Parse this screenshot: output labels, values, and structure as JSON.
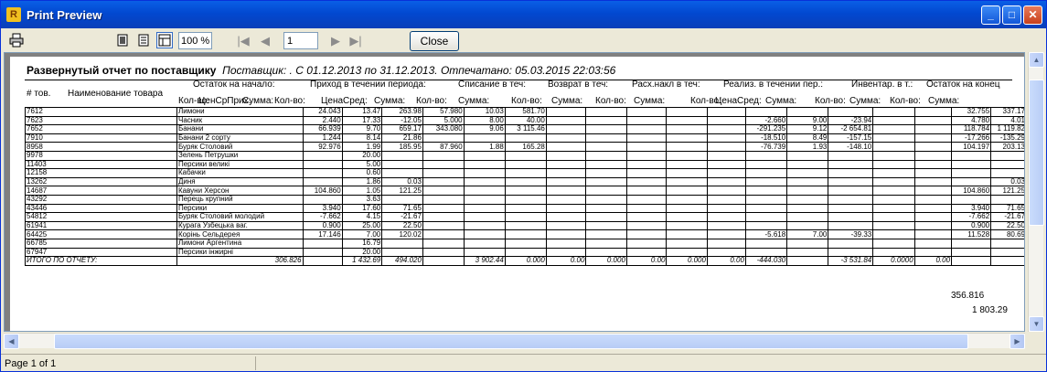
{
  "window": {
    "title": "Print Preview",
    "app_icon_letter": "R"
  },
  "toolbar": {
    "zoom": "100 %",
    "page_number": "1",
    "close_label": "Close",
    "icons": [
      "printer-icon",
      "one-page-icon",
      "page-width-icon",
      "multi-page-icon",
      "first-page-icon",
      "prev-page-icon",
      "next-page-icon",
      "last-page-icon"
    ]
  },
  "report": {
    "title": "Развернутый отчет по поставщику",
    "subtitle": "Поставщик: . С 01.12.2013 по 31.12.2013. Отпечатано: 05.03.2015 22:03:56",
    "col_tov": "# тов.",
    "col_name": "Наименование товара",
    "groups": [
      "Остаток на начало:",
      "Приход в течении периода:",
      "Списание в теч:",
      "Возврат в теч:",
      "Расх.накл в теч:",
      "Реализ. в течении пер.:",
      "Инвентар. в т.:",
      "Остаток на конец"
    ],
    "subheaders": [
      "Кол-во:",
      "ЦенСрПрих:",
      "Сумма:",
      "Кол-во:",
      "ЦенаСред:",
      "Сумма:",
      "Кол-во:",
      "Сумма:",
      "Кол-во:",
      "Сумма:",
      "Кол-во:",
      "Сумма:",
      "Кол-во:",
      "ЦенаСред:",
      "Сумма:",
      "Кол-во:",
      "Сумма:",
      "Кол-во:",
      "Сумма:"
    ],
    "rows": [
      [
        "7612",
        "Лимони",
        "24.043",
        "13.47",
        "263.98",
        "57.980",
        "10.03",
        "581.70",
        "",
        "",
        "",
        "",
        "",
        "",
        "",
        "",
        "",
        "",
        "32.755",
        "337.17"
      ],
      [
        "7623",
        "Часник",
        "2.440",
        "17.33",
        "-12.05",
        "5.000",
        "8.00",
        "40.00",
        "",
        "",
        "",
        "",
        "",
        "-2.660",
        "9.00",
        "-23.94",
        "",
        "",
        "4.780",
        "4.01"
      ],
      [
        "7652",
        "Банани",
        "66.939",
        "9.70",
        "659.17",
        "343.080",
        "9.06",
        "3 115.46",
        "",
        "",
        "",
        "",
        "",
        "-291.235",
        "9.12",
        "-2 654.81",
        "",
        "",
        "118.784",
        "1 119.82"
      ],
      [
        "7910",
        "Банани 2 сорту",
        "1.244",
        "8.14",
        "21.86",
        "",
        "",
        "",
        "",
        "",
        "",
        "",
        "",
        "-18.510",
        "8.49",
        "-157.15",
        "",
        "",
        "-17.266",
        "-135.29"
      ],
      [
        "8958",
        "Буряк Столовий",
        "92.976",
        "1.99",
        "185.95",
        "87.960",
        "1.88",
        "165.28",
        "",
        "",
        "",
        "",
        "",
        "-76.739",
        "1.93",
        "-148.10",
        "",
        "",
        "104.197",
        "203.13"
      ],
      [
        "9978",
        "Зелень Петрушки",
        "",
        "20.00",
        "",
        "",
        "",
        "",
        "",
        "",
        "",
        "",
        "",
        "",
        "",
        "",
        "",
        "",
        "",
        ""
      ],
      [
        "11403",
        "Персики великі",
        "",
        "5.00",
        "",
        "",
        "",
        "",
        "",
        "",
        "",
        "",
        "",
        "",
        "",
        "",
        "",
        "",
        "",
        ""
      ],
      [
        "12158",
        "Кабачки",
        "",
        "0.60",
        "",
        "",
        "",
        "",
        "",
        "",
        "",
        "",
        "",
        "",
        "",
        "",
        "",
        "",
        "",
        ""
      ],
      [
        "13262",
        "Диня",
        "",
        "1.86",
        "0.03",
        "",
        "",
        "",
        "",
        "",
        "",
        "",
        "",
        "",
        "",
        "",
        "",
        "",
        "",
        "0.03"
      ],
      [
        "14687",
        "Кавуни Херсон",
        "104.860",
        "1.05",
        "121.25",
        "",
        "",
        "",
        "",
        "",
        "",
        "",
        "",
        "",
        "",
        "",
        "",
        "",
        "104.860",
        "121.25"
      ],
      [
        "43292",
        "Перець крупний",
        "",
        "3.63",
        "",
        "",
        "",
        "",
        "",
        "",
        "",
        "",
        "",
        "",
        "",
        "",
        "",
        "",
        "",
        ""
      ],
      [
        "43446",
        "Персики",
        "3.940",
        "17.60",
        "71.65",
        "",
        "",
        "",
        "",
        "",
        "",
        "",
        "",
        "",
        "",
        "",
        "",
        "",
        "3.940",
        "71.65"
      ],
      [
        "54812",
        "Буряк Столовий молодий",
        "-7.662",
        "4.15",
        "-21.67",
        "",
        "",
        "",
        "",
        "",
        "",
        "",
        "",
        "",
        "",
        "",
        "",
        "",
        "-7.662",
        "-21.67"
      ],
      [
        "61941",
        "Курага Узбецька ваг.",
        "0.900",
        "25.00",
        "22.50",
        "",
        "",
        "",
        "",
        "",
        "",
        "",
        "",
        "",
        "",
        "",
        "",
        "",
        "0.900",
        "22.50"
      ],
      [
        "64425",
        "Корінь Сельдерея",
        "17.146",
        "7.00",
        "120.02",
        "",
        "",
        "",
        "",
        "",
        "",
        "",
        "",
        "-5.618",
        "7.00",
        "-39.33",
        "",
        "",
        "11.528",
        "80.69"
      ],
      [
        "66785",
        "Лимони Аргентина",
        "",
        "16.79",
        "",
        "",
        "",
        "",
        "",
        "",
        "",
        "",
        "",
        "",
        "",
        "",
        "",
        "",
        "",
        ""
      ],
      [
        "67947",
        "Персики інжирні",
        "",
        "20.00",
        "",
        "",
        "",
        "",
        "",
        "",
        "",
        "",
        "",
        "",
        "",
        "",
        "",
        "",
        "",
        ""
      ]
    ],
    "total_row": [
      "ИТОГО ПО ОТЧЕТУ:",
      "306.826",
      "",
      "1 432.69",
      "494.020",
      "",
      "3 902.44",
      "0.000",
      "0.00",
      "0.000",
      "0.00",
      "0.000",
      "0.00",
      "-444.030",
      "",
      "-3 531.84",
      "0.0000",
      "0.00",
      "",
      ""
    ],
    "after_qty": "356.816",
    "after_sum": "1 803.29"
  },
  "statusbar": {
    "page_info": "Page 1 of 1"
  }
}
